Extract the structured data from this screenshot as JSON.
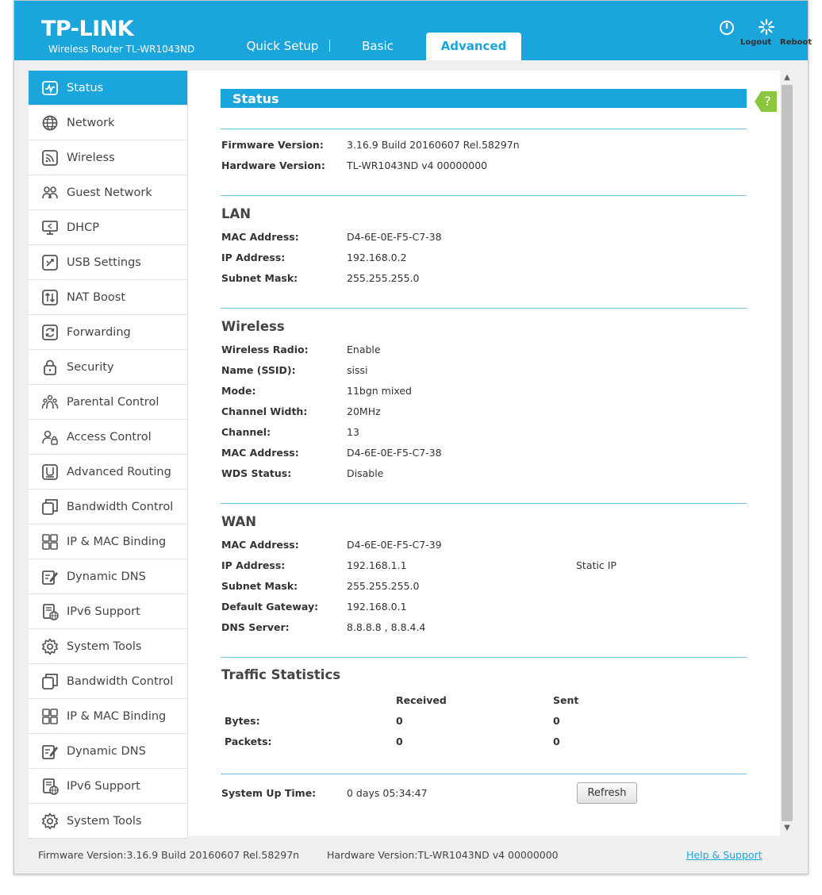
{
  "header": {
    "brand": "TP-LINK",
    "model": "Wireless Router TL-WR1043ND",
    "tabs": [
      {
        "label": "Quick Setup"
      },
      {
        "label": "Basic"
      },
      {
        "label": "Advanced"
      }
    ],
    "logout_label": "Logout",
    "reboot_label": "Reboot",
    "accent_color": "#1aa5dc"
  },
  "sidebar": {
    "items": [
      {
        "label": "Status",
        "icon": "status-icon",
        "active": true
      },
      {
        "label": "Network",
        "icon": "globe-icon"
      },
      {
        "label": "Wireless",
        "icon": "wifi-icon"
      },
      {
        "label": "Guest Network",
        "icon": "guest-icon"
      },
      {
        "label": "DHCP",
        "icon": "monitor-icon"
      },
      {
        "label": "USB Settings",
        "icon": "usb-icon"
      },
      {
        "label": "NAT Boost",
        "icon": "nat-icon"
      },
      {
        "label": "Forwarding",
        "icon": "refresh-icon"
      },
      {
        "label": "Security",
        "icon": "lock-icon"
      },
      {
        "label": "Parental Control",
        "icon": "family-icon"
      },
      {
        "label": "Access Control",
        "icon": "user-lock-icon"
      },
      {
        "label": "Advanced Routing",
        "icon": "routing-icon"
      },
      {
        "label": "Bandwidth Control",
        "icon": "bandwidth-icon"
      },
      {
        "label": "IP & MAC Binding",
        "icon": "binding-icon"
      },
      {
        "label": "Dynamic DNS",
        "icon": "edit-icon"
      },
      {
        "label": "IPv6 Support",
        "icon": "ipv6-icon"
      },
      {
        "label": "System Tools",
        "icon": "gear-icon"
      },
      {
        "label": "Bandwidth Control",
        "icon": "bandwidth-icon"
      },
      {
        "label": "IP & MAC Binding",
        "icon": "binding-icon"
      },
      {
        "label": "Dynamic DNS",
        "icon": "edit-icon"
      },
      {
        "label": "IPv6 Support",
        "icon": "ipv6-icon"
      },
      {
        "label": "System Tools",
        "icon": "gear-icon"
      }
    ]
  },
  "main": {
    "title": "Status",
    "firmware": {
      "label": "Firmware Version:",
      "value": "3.16.9 Build 20160607 Rel.58297n"
    },
    "hardware": {
      "label": "Hardware Version:",
      "value": "TL-WR1043ND v4 00000000"
    },
    "lan": {
      "title": "LAN",
      "mac": {
        "label": "MAC Address:",
        "value": "D4-6E-0E-F5-C7-38"
      },
      "ip": {
        "label": "IP Address:",
        "value": "192.168.0.2"
      },
      "mask": {
        "label": "Subnet Mask:",
        "value": "255.255.255.0"
      }
    },
    "wireless": {
      "title": "Wireless",
      "radio": {
        "label": "Wireless Radio:",
        "value": "Enable"
      },
      "ssid": {
        "label": "Name (SSID):",
        "value": "sissi"
      },
      "mode": {
        "label": "Mode:",
        "value": "11bgn mixed"
      },
      "width": {
        "label": "Channel Width:",
        "value": "20MHz"
      },
      "channel": {
        "label": "Channel:",
        "value": "13"
      },
      "mac": {
        "label": "MAC Address:",
        "value": "D4-6E-0E-F5-C7-38"
      },
      "wds": {
        "label": "WDS Status:",
        "value": "Disable"
      }
    },
    "wan": {
      "title": "WAN",
      "mac": {
        "label": "MAC Address:",
        "value": "D4-6E-0E-F5-C7-39"
      },
      "ip": {
        "label": "IP Address:",
        "value": "192.168.1.1",
        "type": "Static IP"
      },
      "mask": {
        "label": "Subnet Mask:",
        "value": "255.255.255.0"
      },
      "gateway": {
        "label": "Default Gateway:",
        "value": "192.168.0.1"
      },
      "dns": {
        "label": "DNS Server:",
        "value": "8.8.8.8 , 8.8.4.4"
      }
    },
    "traffic": {
      "title": "Traffic Statistics",
      "received_header": "Received",
      "sent_header": "Sent",
      "bytes": {
        "label": "Bytes:",
        "received": "0",
        "sent": "0"
      },
      "packets": {
        "label": "Packets:",
        "received": "0",
        "sent": "0"
      }
    },
    "uptime": {
      "label": "System Up Time:",
      "value": "0 days 05:34:47"
    },
    "refresh_label": "Refresh"
  },
  "footer": {
    "firmware": "Firmware Version:3.16.9 Build 20160607 Rel.58297n",
    "hardware": "Hardware Version:TL-WR1043ND v4 00000000",
    "help_link": "Help & Support"
  }
}
